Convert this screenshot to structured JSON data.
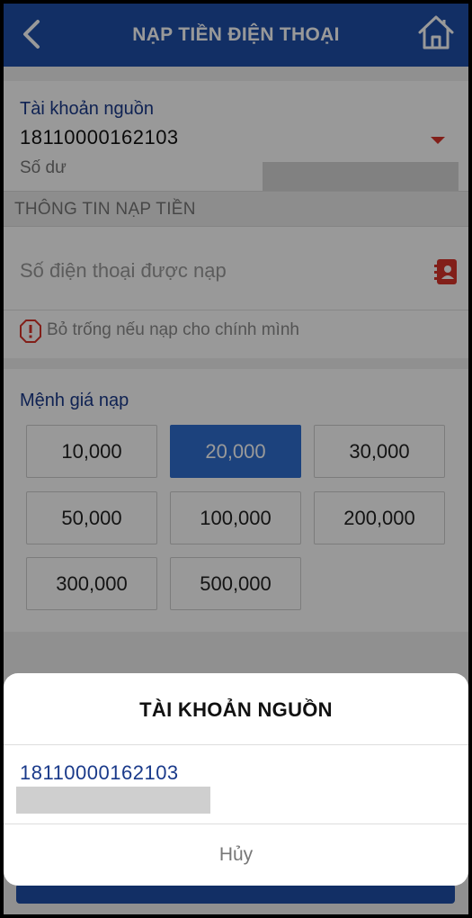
{
  "header": {
    "title": "NẠP TIỀN ĐIỆN THOẠI",
    "back_icon": "chevron-left-icon",
    "home_icon": "home-icon"
  },
  "account": {
    "label": "Tài khoản nguồn",
    "number": "18110000162103",
    "balance_label": "Số dư"
  },
  "topup_info": {
    "section_title": "THÔNG TIN NẠP TIỀN",
    "phone_placeholder": "Số điện thoại được nạp",
    "contact_icon": "contact-book-icon",
    "hint_icon": "warning-icon",
    "hint": "Bỏ trống nếu nạp cho chính mình"
  },
  "denominations": {
    "label": "Mệnh giá nạp",
    "selected": "20,000",
    "items": [
      "10,000",
      "20,000",
      "30,000",
      "50,000",
      "100,000",
      "200,000",
      "300,000",
      "500,000"
    ]
  },
  "action_sheet": {
    "title": "TÀI KHOẢN NGUỒN",
    "accounts": [
      "18110000162103"
    ],
    "cancel_label": "Hủy"
  },
  "colors": {
    "brand_blue": "#1f4fa8",
    "selected_blue": "#2f6fd0",
    "accent_red": "#d9342b",
    "label_blue": "#1a3a8a"
  }
}
